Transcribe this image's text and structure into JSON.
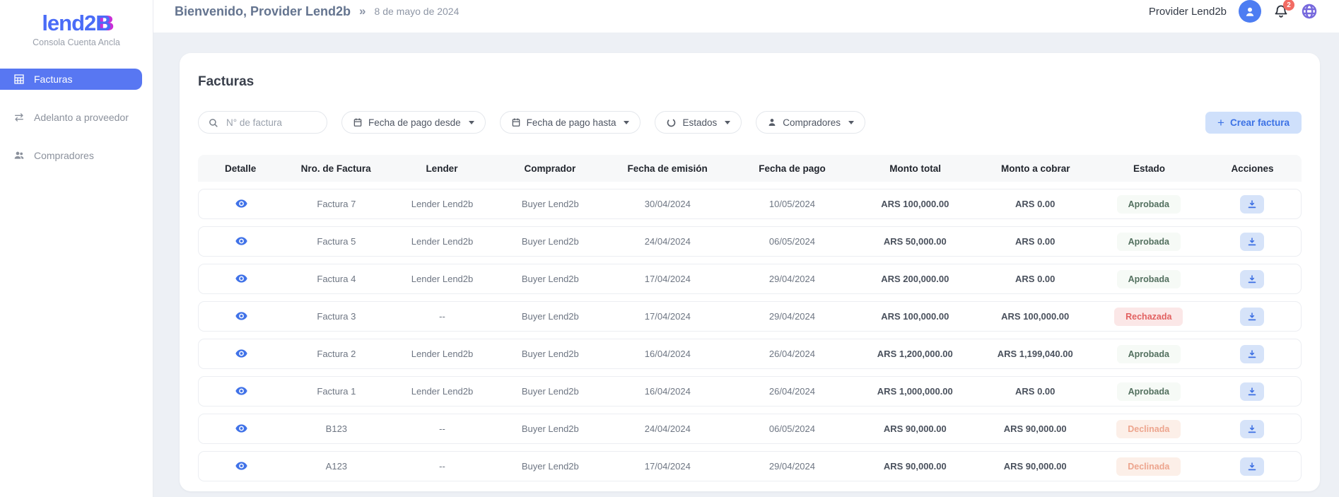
{
  "brand": {
    "logo_main": "lend2",
    "logo_accent": "B",
    "subtitle": "Consola Cuenta Ancla",
    "accent_color": "#4a6cf7",
    "accent_shadow_color": "#c92fd6"
  },
  "sidebar": {
    "items": [
      {
        "label": "Facturas",
        "icon": "table-grid-icon",
        "active": true
      },
      {
        "label": "Adelanto a proveedor",
        "icon": "transfer-arrows-icon",
        "active": false
      },
      {
        "label": "Compradores",
        "icon": "people-icon",
        "active": false
      }
    ],
    "active_bg": "#5877f2"
  },
  "header": {
    "welcome": "Bienvenido, Provider Lend2b",
    "separator": "»",
    "date": "8 de mayo de 2024",
    "user_name": "Provider Lend2b",
    "notifications_count": "2"
  },
  "page": {
    "title": "Facturas"
  },
  "filters": {
    "search_placeholder": "N° de factura",
    "date_from_label": "Fecha de pago desde",
    "date_to_label": "Fecha de pago hasta",
    "states_label": "Estados",
    "buyers_label": "Compradores",
    "create_plus": "+",
    "create_label": "Crear factura",
    "create_bg": "#cfe0fb",
    "create_text": "#3c72e5"
  },
  "table": {
    "columns": [
      "Detalle",
      "Nro. de Factura",
      "Lender",
      "Comprador",
      "Fecha de emisión",
      "Fecha de pago",
      "Monto total",
      "Monto a cobrar",
      "Estado",
      "Acciones"
    ],
    "rows": [
      {
        "factura": "Factura 7",
        "lender": "Lender Lend2b",
        "comprador": "Buyer Lend2b",
        "emision": "30/04/2024",
        "pago": "10/05/2024",
        "monto_total": "ARS 100,000.00",
        "monto_cobrar": "ARS 0.00",
        "estado": "Aprobada"
      },
      {
        "factura": "Factura 5",
        "lender": "Lender Lend2b",
        "comprador": "Buyer Lend2b",
        "emision": "24/04/2024",
        "pago": "06/05/2024",
        "monto_total": "ARS 50,000.00",
        "monto_cobrar": "ARS 0.00",
        "estado": "Aprobada"
      },
      {
        "factura": "Factura 4",
        "lender": "Lender Lend2b",
        "comprador": "Buyer Lend2b",
        "emision": "17/04/2024",
        "pago": "29/04/2024",
        "monto_total": "ARS 200,000.00",
        "monto_cobrar": "ARS 0.00",
        "estado": "Aprobada"
      },
      {
        "factura": "Factura 3",
        "lender": "--",
        "comprador": "Buyer Lend2b",
        "emision": "17/04/2024",
        "pago": "29/04/2024",
        "monto_total": "ARS 100,000.00",
        "monto_cobrar": "ARS 100,000.00",
        "estado": "Rechazada"
      },
      {
        "factura": "Factura 2",
        "lender": "Lender Lend2b",
        "comprador": "Buyer Lend2b",
        "emision": "16/04/2024",
        "pago": "26/04/2024",
        "monto_total": "ARS 1,200,000.00",
        "monto_cobrar": "ARS 1,199,040.00",
        "estado": "Aprobada"
      },
      {
        "factura": "Factura 1",
        "lender": "Lender Lend2b",
        "comprador": "Buyer Lend2b",
        "emision": "16/04/2024",
        "pago": "26/04/2024",
        "monto_total": "ARS 1,000,000.00",
        "monto_cobrar": "ARS 0.00",
        "estado": "Aprobada"
      },
      {
        "factura": "B123",
        "lender": "--",
        "comprador": "Buyer Lend2b",
        "emision": "24/04/2024",
        "pago": "06/05/2024",
        "monto_total": "ARS 90,000.00",
        "monto_cobrar": "ARS 90,000.00",
        "estado": "Declinada"
      },
      {
        "factura": "A123",
        "lender": "--",
        "comprador": "Buyer Lend2b",
        "emision": "17/04/2024",
        "pago": "29/04/2024",
        "monto_total": "ARS 90,000.00",
        "monto_cobrar": "ARS 90,000.00",
        "estado": "Declinada"
      }
    ]
  },
  "statuses": {
    "Aprobada": {
      "bg": "#f6faf6",
      "text": "#53705f"
    },
    "Rechazada": {
      "bg": "#fbe7e7",
      "text": "#e26161"
    },
    "Declinada": {
      "bg": "#fcefe8",
      "text": "#eda58e"
    }
  }
}
